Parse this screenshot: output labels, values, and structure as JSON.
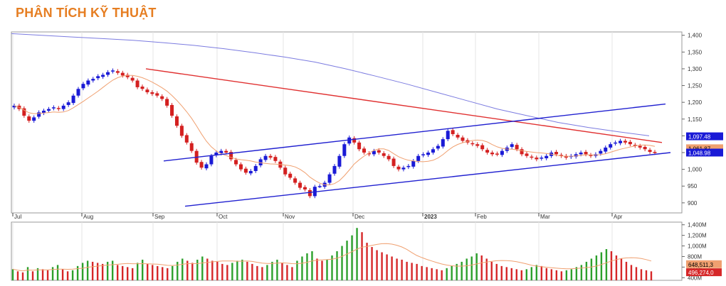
{
  "header": {
    "title": "PHÂN TÍCH KỸ THUẬT"
  },
  "colors": {
    "title": "#e67e22",
    "up": "#1a1ad6",
    "down": "#d42020",
    "vol_up": "#2ca02c",
    "vol_down": "#d62728",
    "ma_long": "#7b7be0",
    "ma_short": "#f0a070",
    "downtrend": "#e03030",
    "channel": "#2020d0"
  },
  "chart_data": [
    {
      "type": "candlestick",
      "title": "",
      "y_ticks": [
        "1,400",
        "1,350",
        "1,300",
        "1,250",
        "1,200",
        "1,150",
        "1,100",
        "1,050",
        "1,000",
        "950",
        "900"
      ],
      "ylim": [
        870,
        1410
      ],
      "months": [
        "Jul",
        "Aug",
        "Sep",
        "Oct",
        "Nov",
        "Dec",
        "2023",
        "Feb",
        "Mar",
        "Apr"
      ],
      "price_tags": [
        {
          "label": "1,097.48",
          "value": 1097.48,
          "color": "#1a1ad6",
          "text": "#ffffff"
        },
        {
          "label": "1,061.87",
          "value": 1061.87,
          "color": "#f0a070",
          "text": "#000000"
        },
        {
          "label": "1,048.98",
          "value": 1048.98,
          "color": "#1a1ad6",
          "text": "#ffffff"
        }
      ],
      "closes": [
        1190,
        1180,
        1160,
        1145,
        1155,
        1170,
        1175,
        1180,
        1185,
        1180,
        1190,
        1200,
        1220,
        1240,
        1255,
        1265,
        1270,
        1278,
        1282,
        1290,
        1295,
        1288,
        1280,
        1275,
        1265,
        1245,
        1240,
        1230,
        1225,
        1220,
        1210,
        1190,
        1160,
        1130,
        1100,
        1080,
        1055,
        1020,
        1005,
        1015,
        1040,
        1050,
        1055,
        1050,
        1030,
        1015,
        1000,
        990,
        995,
        1010,
        1030,
        1040,
        1035,
        1025,
        1005,
        985,
        975,
        960,
        945,
        940,
        920,
        948,
        950,
        960,
        985,
        1010,
        1040,
        1075,
        1095,
        1080,
        1060,
        1050,
        1045,
        1055,
        1050,
        1040,
        1030,
        1010,
        1000,
        1005,
        1010,
        1025,
        1040,
        1045,
        1050,
        1060,
        1070,
        1090,
        1115,
        1105,
        1095,
        1085,
        1080,
        1075,
        1070,
        1060,
        1050,
        1045,
        1045,
        1055,
        1065,
        1075,
        1060,
        1045,
        1040,
        1035,
        1030,
        1035,
        1040,
        1050,
        1045,
        1040,
        1035,
        1040,
        1045,
        1050,
        1045,
        1040,
        1045,
        1055,
        1065,
        1075,
        1080,
        1085,
        1080,
        1075,
        1070,
        1065,
        1060,
        1052,
        1049
      ],
      "overlays": {
        "downtrend_line": [
          {
            "x": 205,
            "y": 1300
          },
          {
            "x": 930,
            "y": 1080
          }
        ],
        "channel_upper": [
          {
            "x": 230,
            "y": 1025
          },
          {
            "x": 935,
            "y": 1195
          }
        ],
        "channel_lower": [
          {
            "x": 260,
            "y": 890
          },
          {
            "x": 942,
            "y": 1050
          }
        ],
        "ma_long": [
          1405,
          1400,
          1395,
          1390,
          1385,
          1378,
          1370,
          1360,
          1348,
          1335,
          1320,
          1300,
          1278,
          1255,
          1230,
          1205,
          1180,
          1160,
          1140,
          1125,
          1112,
          1100
        ],
        "ma_short_shift": 8
      }
    },
    {
      "type": "bar",
      "title": "",
      "y_ticks": [
        "1,400M",
        "1,200M",
        "1,000M",
        "800M",
        "600M",
        "400M"
      ],
      "ylim": [
        350,
        1450
      ],
      "volume_tags": [
        {
          "label": "648,511,3",
          "value": 648,
          "color": "#f0a070",
          "text": "#000000"
        },
        {
          "label": "496,274,0",
          "value": 496,
          "color": "#d62728",
          "text": "#ffffff"
        }
      ],
      "values": [
        560,
        520,
        500,
        600,
        520,
        580,
        560,
        540,
        600,
        640,
        560,
        520,
        540,
        620,
        680,
        720,
        700,
        680,
        660,
        700,
        720,
        640,
        620,
        600,
        580,
        680,
        740,
        660,
        640,
        620,
        600,
        580,
        620,
        700,
        760,
        720,
        680,
        740,
        800,
        760,
        720,
        700,
        660,
        640,
        680,
        720,
        740,
        700,
        660,
        620,
        600,
        640,
        700,
        740,
        680,
        640,
        600,
        720,
        800,
        860,
        900,
        760,
        720,
        740,
        820,
        900,
        1000,
        1100,
        1200,
        1340,
        1260,
        1060,
        980,
        920,
        880,
        840,
        800,
        760,
        740,
        700,
        680,
        660,
        620,
        600,
        580,
        560,
        540,
        580,
        620,
        660,
        700,
        760,
        800,
        860,
        820,
        760,
        700,
        660,
        620,
        600,
        580,
        560,
        540,
        560,
        600,
        640,
        620,
        580,
        560,
        540,
        520,
        540,
        560,
        600,
        640,
        700,
        760,
        820,
        880,
        940,
        900,
        820,
        760,
        700,
        640,
        600,
        560,
        540,
        520
      ]
    }
  ]
}
